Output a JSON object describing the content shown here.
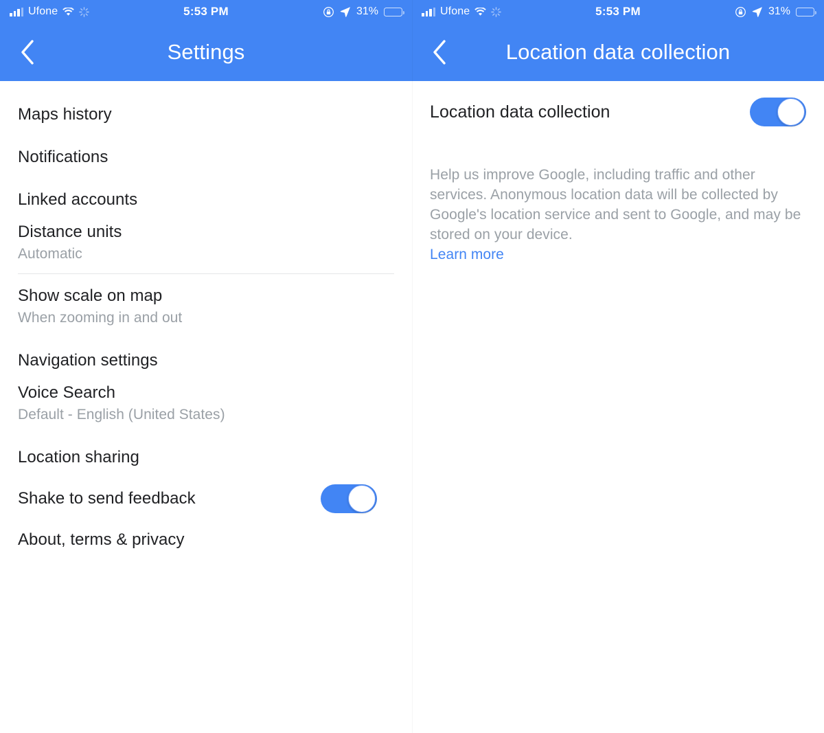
{
  "colors": {
    "accent": "#4285F4",
    "header_bg": "#4285F4",
    "title_text": "#202124",
    "secondary_text": "#9aa0a6",
    "link": "#4285F4",
    "divider": "#e4e6e8",
    "toggle_on": "#4285F4"
  },
  "status_bar": {
    "carrier": "Ufone",
    "time": "5:53 PM",
    "battery_percent": "31%",
    "battery_level": 31,
    "icons": {
      "signal": "signal-bars-icon",
      "wifi": "wifi-icon",
      "activity": "activity-spinner-icon",
      "rotation_lock": "rotation-lock-icon",
      "location": "location-arrow-icon",
      "battery": "battery-icon"
    }
  },
  "left_panel": {
    "header": {
      "title": "Settings",
      "back_icon": "chevron-left-icon"
    },
    "items": [
      {
        "title": "Maps history",
        "subtitle": "",
        "toggle": null
      },
      {
        "title": "Notifications",
        "subtitle": "",
        "toggle": null
      },
      {
        "title": "Linked accounts",
        "subtitle": "",
        "toggle": null
      },
      {
        "title": "Distance units",
        "subtitle": "Automatic",
        "toggle": null
      },
      {
        "title": "Show scale on map",
        "subtitle": "When zooming in and out",
        "toggle": null
      },
      {
        "title": "Navigation settings",
        "subtitle": "",
        "toggle": null
      },
      {
        "title": "Voice Search",
        "subtitle": "Default - English (United States)",
        "toggle": null
      },
      {
        "title": "Location sharing",
        "subtitle": "",
        "toggle": null
      },
      {
        "title": "Shake to send feedback",
        "subtitle": "",
        "toggle": "on"
      },
      {
        "title": "About, terms & privacy",
        "subtitle": "",
        "toggle": null
      }
    ]
  },
  "right_panel": {
    "header": {
      "title": "Location data collection",
      "back_icon": "chevron-left-icon"
    },
    "setting": {
      "label": "Location data collection",
      "toggle": "on"
    },
    "description": "Help us improve Google, including traffic and other services. Anonymous location data will be collected by Google's location service and sent to Google, and may be stored on your device.",
    "learn_more": "Learn more"
  }
}
